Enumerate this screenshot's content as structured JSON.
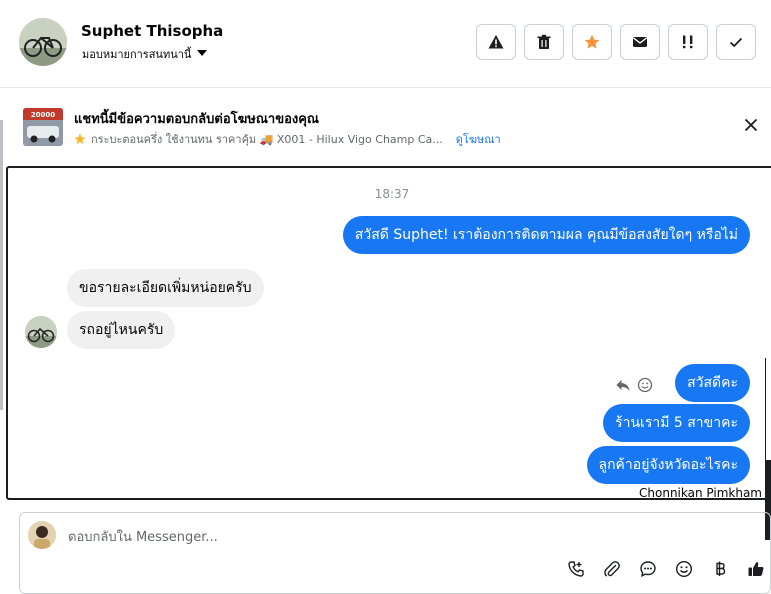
{
  "header": {
    "contact_name": "Suphet Thisopha",
    "assign_label": "มอบหมายการสนทนานี้",
    "actions": [
      {
        "name": "warning-button",
        "icon": "warning-icon"
      },
      {
        "name": "delete-button",
        "icon": "trash-icon"
      },
      {
        "name": "star-button",
        "icon": "star-icon"
      },
      {
        "name": "mark-unread-button",
        "icon": "envelope-icon"
      },
      {
        "name": "follow-up-button",
        "icon": "exclamation-icon"
      },
      {
        "name": "mark-done-button",
        "icon": "check-icon"
      }
    ]
  },
  "ad": {
    "title": "แชทนี้มีข้อความตอบกลับต่อโฆษณาของคุณ",
    "subtitle": "กระบะตอนครึ่ง ใช้งานทน ราคาคุ้ม 🚚 X001 - Hilux Vigo Champ Ca...",
    "link": "ดูโฆษณา",
    "thumb_text": "20000"
  },
  "chat": {
    "timestamp": "18:37",
    "messages": [
      {
        "dir": "out",
        "text": "สวัสดี Suphet! เราต้องการติดตามผล คุณมีข้อสงสัยใดๆ หรือไม่"
      },
      {
        "dir": "in",
        "text": "ขอรายละเอียดเพิ่มหน่อยครับ"
      },
      {
        "dir": "in",
        "text": "รถอยู่ไหนครับ"
      },
      {
        "dir": "out",
        "text": "สวัสดีคะ"
      },
      {
        "dir": "out",
        "text": "ร้านเรามี 5 สาขาคะ"
      },
      {
        "dir": "out",
        "text": "ลูกค้าอยู่จังหวัดอะไรคะ"
      }
    ],
    "sender_name": "Chonnikan Pimkham"
  },
  "composer": {
    "placeholder": "ตอบกลับใน Messenger...",
    "tools": [
      "call-icon",
      "attachment-icon",
      "chat-bubble-icon",
      "emoji-icon",
      "baht-icon",
      "thumbs-up-icon"
    ]
  },
  "colors": {
    "accent": "#1877f2",
    "bubble_in": "#f0f0f0",
    "star": "#f7923a"
  }
}
